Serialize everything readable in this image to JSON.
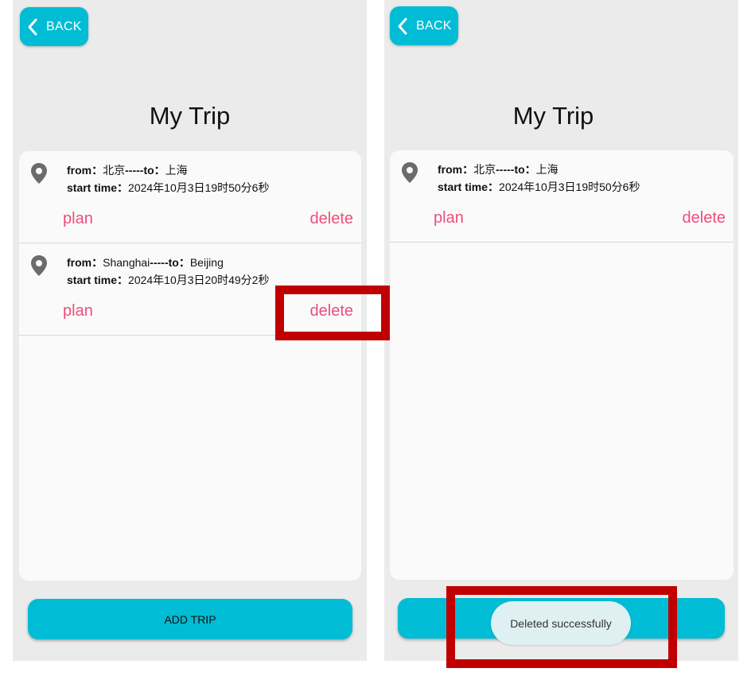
{
  "colors": {
    "accent": "#00bcd4",
    "action_text": "#ec4e7c",
    "highlight": "#c00000",
    "toast_bg": "#dff0f3"
  },
  "icons": {
    "back": "chevron-left-icon",
    "pin": "location-pin-icon"
  },
  "left_screen": {
    "back_label": "BACK",
    "title": "My Trip",
    "trips": [
      {
        "from_label": "from：",
        "from": "北京",
        "separator": "-----",
        "to_label": "to：",
        "to": "上海",
        "start_label": "start time：",
        "start": "2024年10月3日19时50分6秒",
        "plan_label": "plan",
        "delete_label": "delete"
      },
      {
        "from_label": "from：",
        "from": "Shanghai",
        "separator": "-----",
        "to_label": "to：",
        "to": "Beijing",
        "start_label": "start time：",
        "start": "2024年10月3日20时49分2秒",
        "plan_label": "plan",
        "delete_label": "delete"
      }
    ],
    "add_trip_label": "ADD TRIP"
  },
  "right_screen": {
    "back_label": "BACK",
    "title": "My Trip",
    "trips": [
      {
        "from_label": "from：",
        "from": "北京",
        "separator": "-----",
        "to_label": "to：",
        "to": "上海",
        "start_label": "start time：",
        "start": "2024年10月3日19时50分6秒",
        "plan_label": "plan",
        "delete_label": "delete"
      }
    ],
    "toast": "Deleted successfully"
  }
}
